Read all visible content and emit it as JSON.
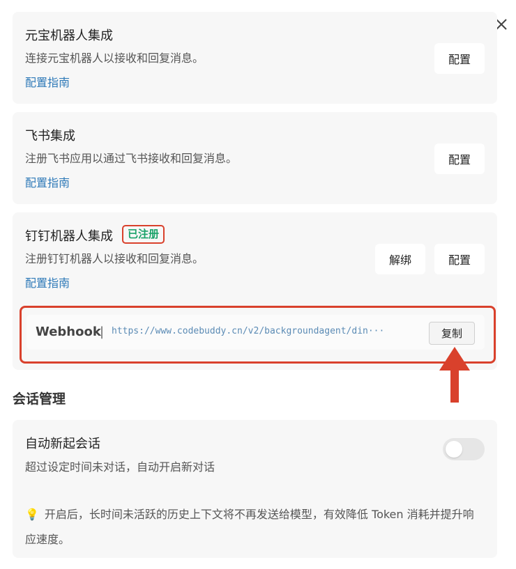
{
  "close_icon_label": "×",
  "cards": [
    {
      "title": "元宝机器人集成",
      "desc": "连接元宝机器人以接收和回复消息。",
      "guide": "配置指南",
      "config_button": "配置"
    },
    {
      "title": "飞书集成",
      "desc": "注册飞书应用以通过飞书接收和回复消息。",
      "guide": "配置指南",
      "config_button": "配置"
    },
    {
      "title": "钉钉机器人集成",
      "badge": "已注册",
      "desc": "注册钉钉机器人以接收和回复消息。",
      "guide": "配置指南",
      "unbind_button": "解绑",
      "config_button": "配置",
      "webhook": {
        "label": "Webhook",
        "separator": "|",
        "url": "https://www.codebuddy.cn/v2/backgroundagent/din···",
        "copy_button": "复制"
      }
    }
  ],
  "session": {
    "section_title": "会话管理",
    "auto_new_title": "自动新起会话",
    "auto_new_desc": "超过设定时间未对话，自动开启新对话",
    "toggle_on": false,
    "tip_icon": "💡",
    "tip_text": "开启后，长时间未活跃的历史上下文将不再发送给模型，有效降低 Token 消耗并提升响应速度。"
  },
  "colors": {
    "accent_link": "#2f7ab8",
    "registered": "#1aa36a",
    "highlight_red": "#d9412c"
  }
}
